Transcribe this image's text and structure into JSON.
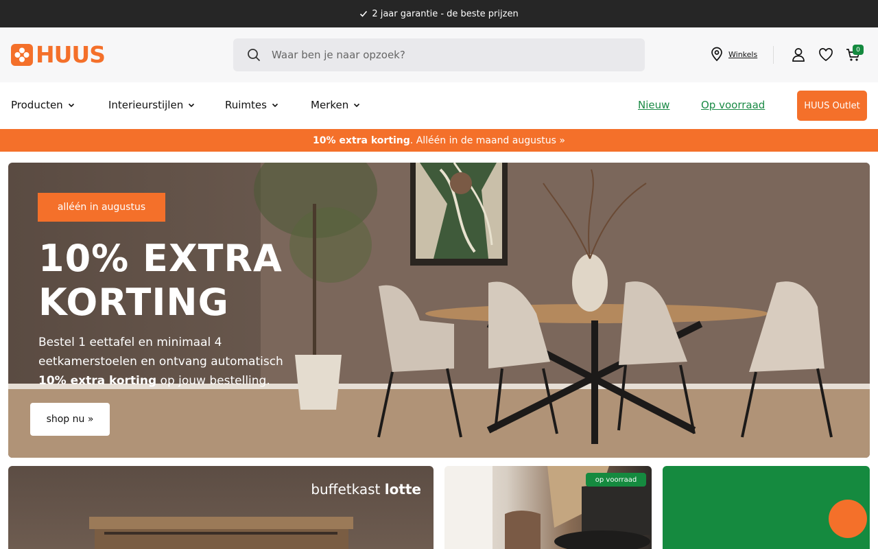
{
  "topbar": {
    "text": "2 jaar garantie - de beste prijzen"
  },
  "header": {
    "logo_text": "HUUS",
    "search_placeholder": "Waar ben je naar opzoek?",
    "store_label": "Winkels",
    "cart_count": "0"
  },
  "nav": {
    "items": [
      {
        "label": "Producten"
      },
      {
        "label": "Interieurstijlen"
      },
      {
        "label": "Ruimtes"
      },
      {
        "label": "Merken"
      }
    ],
    "link_new": "Nieuw",
    "link_stock": "Op voorraad",
    "outlet": "HUUS Outlet"
  },
  "promo": {
    "bold": "10% extra korting",
    "text": ". Alléén in de maand augustus »"
  },
  "hero": {
    "badge": "alléén in augustus",
    "title": "10% EXTRA KORTING",
    "text_1": "Bestel 1 eettafel en minimaal 4 eetkamerstoelen en ontvang automatisch ",
    "text_bold": "10% extra korting",
    "text_2": " op jouw bestelling.",
    "button": "shop nu »"
  },
  "cards": {
    "card1_title_light": "buffetkast ",
    "card1_title_bold": "lotte",
    "card2_badge": "op voorraad"
  },
  "colors": {
    "brand_orange": "#f4702a",
    "brand_green": "#158a3f",
    "topbar_bg": "#262626"
  }
}
